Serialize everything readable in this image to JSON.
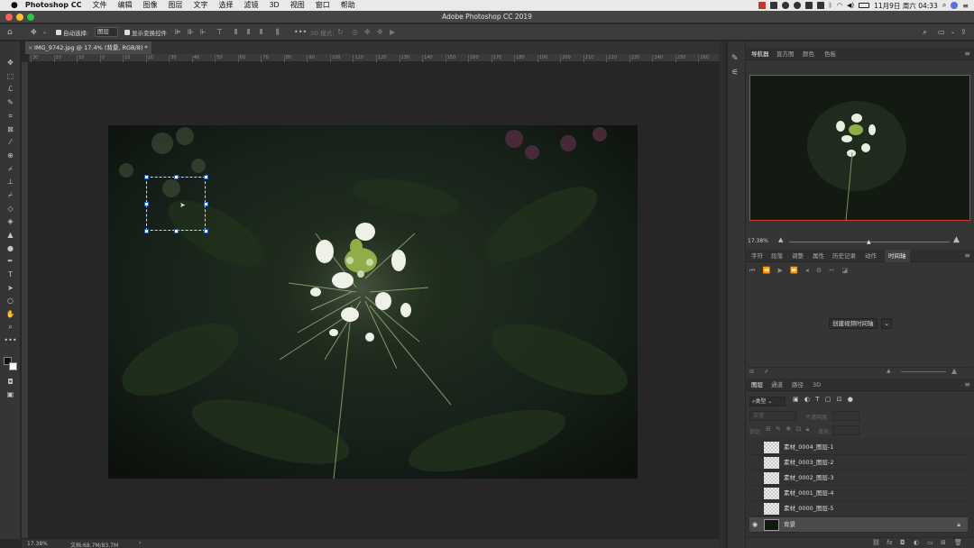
{
  "menubar": {
    "apple": "",
    "app_name": "Photoshop CC",
    "items": [
      "文件",
      "编辑",
      "图像",
      "图层",
      "文字",
      "选择",
      "滤镜",
      "3D",
      "视图",
      "窗口",
      "帮助"
    ],
    "datetime": "11月9日 周六 04:33"
  },
  "window": {
    "title": "Adobe Photoshop CC 2019"
  },
  "options_bar": {
    "auto_select_label": "自动选择:",
    "auto_select_value": "图层",
    "show_transform_label": "显示变换控件",
    "mode_3d_label": "3D 模式:"
  },
  "document": {
    "tab_label": "IMG_9742.jpg @ 17.4% (背景, RGB/8) *",
    "zoom_status": "17.38%",
    "doc_info": "文档:68.7M/83.7M",
    "status_arrow": "›"
  },
  "ruler": {
    "top_ticks": [
      "30",
      "20",
      "10",
      "0",
      "10",
      "20",
      "30",
      "40",
      "50",
      "60",
      "70",
      "80",
      "90",
      "100",
      "110",
      "120",
      "130",
      "140",
      "150",
      "160",
      "170",
      "180",
      "190",
      "200",
      "210",
      "220",
      "230",
      "240",
      "250",
      "260"
    ]
  },
  "navigator_panel": {
    "tabs": [
      "导航器",
      "直方图",
      "颜色",
      "色板"
    ],
    "active_tab": "导航器",
    "zoom": "17.38%",
    "zoom_slider": 0.5
  },
  "timeline_panel": {
    "tabs": [
      "字符",
      "段落",
      "调整",
      "属性",
      "历史记录",
      "动作",
      "时间轴"
    ],
    "active_tab": "时间轴",
    "create_button": "创建视频时间轴"
  },
  "layers_panel": {
    "tabs": [
      "图层",
      "通道",
      "路径",
      "3D"
    ],
    "active_tab": "图层",
    "filter_label": "类型",
    "blend_mode": "正常",
    "opacity_label": "不透明度:",
    "lock_label": "锁定:",
    "fill_label": "填充:",
    "layers": [
      {
        "name": "素材_0004_图层-1",
        "visible": false,
        "selected": false
      },
      {
        "name": "素材_0003_图层-2",
        "visible": false,
        "selected": false
      },
      {
        "name": "素材_0002_图层-3",
        "visible": false,
        "selected": false
      },
      {
        "name": "素材_0001_图层-4",
        "visible": false,
        "selected": false
      },
      {
        "name": "素材_0000_图层-5",
        "visible": false,
        "selected": false
      },
      {
        "name": "背景",
        "visible": true,
        "selected": true,
        "locked": true
      }
    ]
  },
  "colors": {
    "nav_highlight": "#cf3b2f",
    "selection_handle": "#2660b8",
    "close": "#ff5f57",
    "minimize": "#febc2e",
    "maximize": "#28c840"
  },
  "icons": {
    "toolbar": [
      "move-icon",
      "marquee-icon",
      "lasso-icon",
      "quick-select-icon",
      "crop-icon",
      "frame-icon",
      "eyedropper-icon",
      "healing-icon",
      "brush-icon",
      "stamp-icon",
      "history-brush-icon",
      "eraser-icon",
      "gradient-icon",
      "blur-icon",
      "dodge-icon",
      "pen-icon",
      "type-icon",
      "path-select-icon",
      "shape-icon",
      "hand-icon",
      "zoom-icon",
      "more-icon"
    ]
  }
}
